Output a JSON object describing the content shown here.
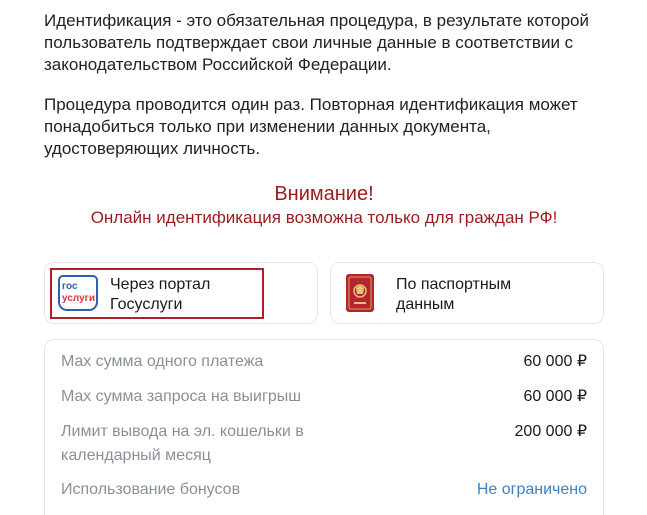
{
  "intro": {
    "paragraph1": "Идентификация - это обязательная процедура, в результате которой пользователь подтверждает свои личные данные в соответствии с законодательством Российской Федерации.",
    "paragraph2": "Процедура проводится один раз. Повторная идентификация может понадобиться только при изменении данных документа, удостоверяющих личность."
  },
  "warning": {
    "title": "Внимание!",
    "text": "Онлайн идентификация возможна только для граждан РФ!"
  },
  "methods": {
    "gosuslugi": {
      "line1": "Через портал",
      "line2": "Госуслуги",
      "logo_text_top": "гос",
      "logo_text_bottom": "услуги"
    },
    "passport": {
      "line1": "По паспортным",
      "line2": "данным"
    }
  },
  "limits": [
    {
      "label": "Max сумма одного платежа",
      "value": "60 000 ₽"
    },
    {
      "label": "Max сумма запроса на выигрыш",
      "value": "60 000 ₽"
    },
    {
      "label": "Лимит вывода на эл. кошельки в календарный месяц",
      "value": "200 000 ₽"
    },
    {
      "label": "Использование бонусов",
      "value": "Не ограничено"
    }
  ],
  "colors": {
    "warning": "#9b1c1c",
    "highlight_border": "#b21d2c",
    "link": "#3b82c4",
    "muted": "#8a9099",
    "passport_red": "#b3262f"
  }
}
